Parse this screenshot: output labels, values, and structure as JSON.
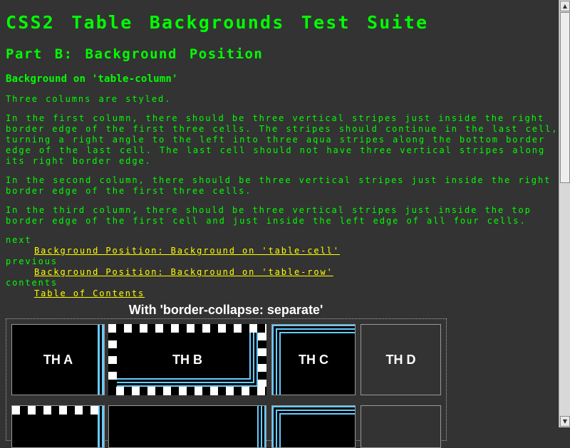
{
  "page": {
    "title": "CSS2 Table Backgrounds Test Suite",
    "part": "Part B: Background Position",
    "section": "Background on 'table-column'",
    "paragraphs": [
      "Three columns are styled.",
      "In the first column, there should be three vertical stripes just inside the right border edge of the first three cells. The stripes should continue in the last cell, turning a right angle to the left into three aqua stripes along the bottom border edge of the last cell. The last cell should not have three vertical stripes along its right border edge.",
      "In the second column, there should be three vertical stripes just inside the right border edge of the first three cells.",
      "In the third column, there should be three vertical stripes just inside the top border edge of the first cell and just inside the left edge of all four cells."
    ]
  },
  "nav": {
    "next_label": "next",
    "next_link": "Background Position: Background on 'table-cell'",
    "previous_label": "previous",
    "previous_link": "Background Position: Background on 'table-row'",
    "contents_label": "contents",
    "contents_link": "Table of Contents"
  },
  "table": {
    "caption": "With 'border-collapse: separate'",
    "headers": [
      "TH A",
      "TH B",
      "TH C",
      "TH D"
    ]
  },
  "colors": {
    "background": "#333333",
    "text": "#00ff00",
    "link": "#ffff00",
    "stripe": "#66ccff"
  }
}
